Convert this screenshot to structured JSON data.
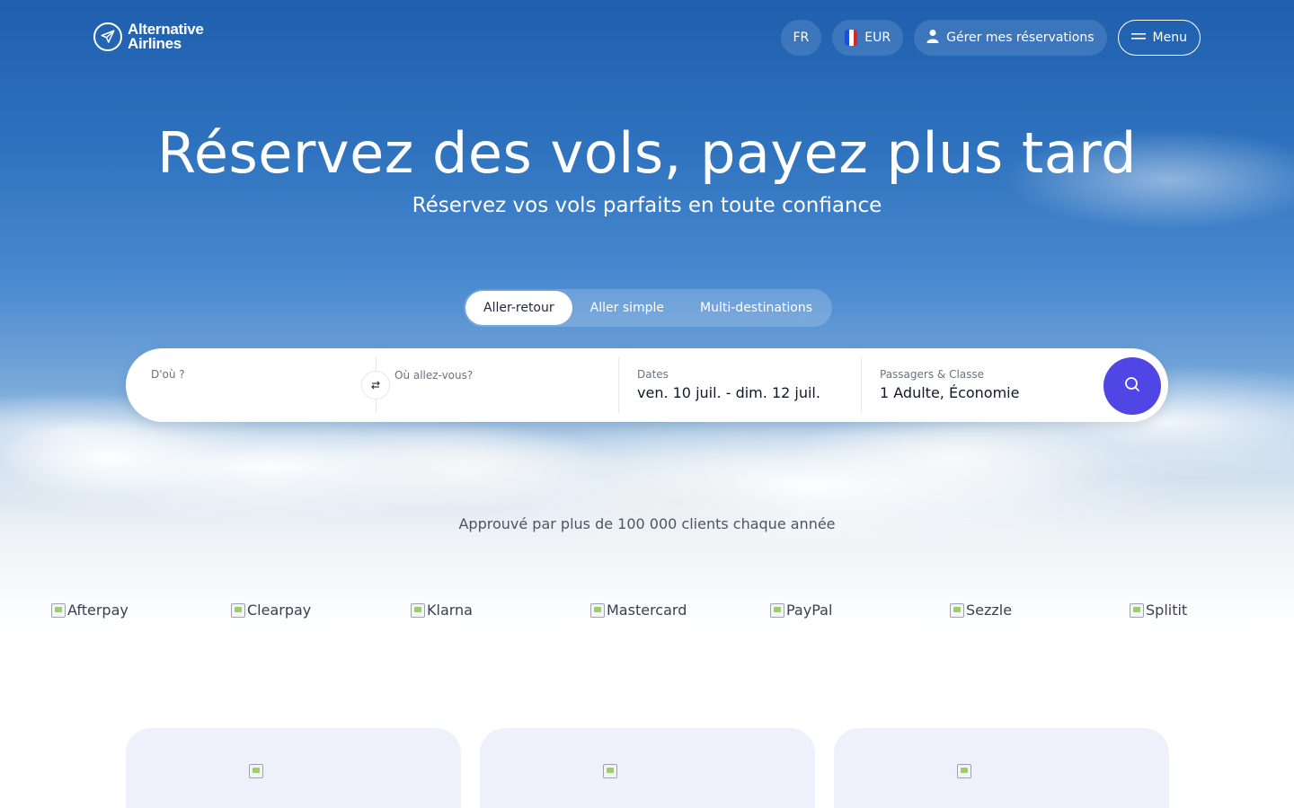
{
  "brand": {
    "name_line1": "Alternative",
    "name_line2": "Airlines"
  },
  "nav": {
    "language": "FR",
    "currency": "EUR",
    "manage_bookings": "Gérer mes réservations",
    "menu": "Menu"
  },
  "hero": {
    "title": "Réservez des vols, payez plus tard",
    "subtitle": "Réservez vos vols parfaits en toute confiance"
  },
  "trip_types": [
    {
      "label": "Aller-retour",
      "active": true
    },
    {
      "label": "Aller simple",
      "active": false
    },
    {
      "label": "Multi-destinations",
      "active": false
    }
  ],
  "search": {
    "from_label": "D'où ?",
    "from_value": "",
    "to_label": "Où allez-vous?",
    "to_value": "",
    "dates_label": "Dates",
    "dates_value": "ven. 10 juil. - dim. 12 juil.",
    "passengers_label": "Passagers & Classe",
    "passengers_value": "1 Adulte, Économie"
  },
  "trust": {
    "text": "Approuvé par plus de 100 000 clients chaque année"
  },
  "payment_logos": [
    "Afterpay",
    "Clearpay",
    "Klarna",
    "Mastercard",
    "PayPal",
    "Sezzle",
    "Splitit"
  ],
  "colors": {
    "accent": "#5046e5",
    "sky_top": "#1f5fae",
    "card_bg": "#eef0fb"
  },
  "icons": {
    "logo": "paper-plane-icon",
    "user": "user-icon",
    "menu": "hamburger-icon",
    "swap": "swap-arrows-icon",
    "search": "search-icon",
    "flag": "france-flag-icon"
  }
}
